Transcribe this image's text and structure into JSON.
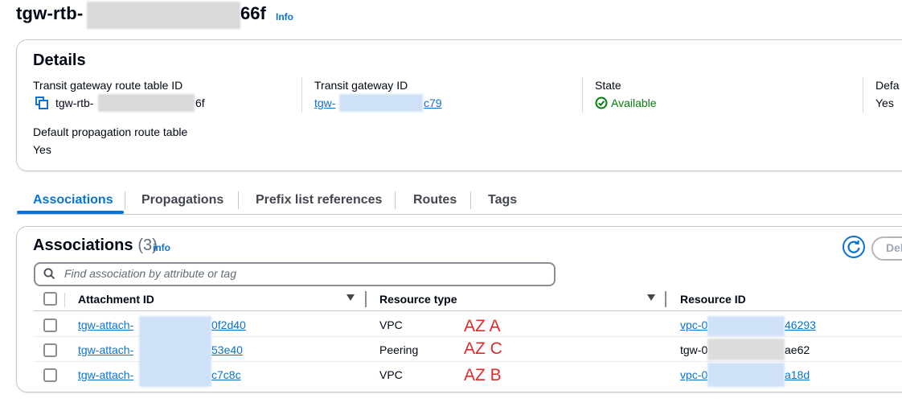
{
  "header": {
    "title_prefix": "tgw-rtb-",
    "title_suffix": "66f",
    "info": "Info"
  },
  "details": {
    "heading": "Details",
    "route_table_id": {
      "label": "Transit gateway route table ID",
      "prefix": "tgw-rtb-",
      "suffix": "6f"
    },
    "gateway_id": {
      "label": "Transit gateway ID",
      "prefix": "tgw-",
      "suffix": "c79"
    },
    "state": {
      "label": "State",
      "value": "Available"
    },
    "default_assoc": {
      "label": "Defa",
      "value": "Yes"
    },
    "default_propagation": {
      "label": "Default propagation route table",
      "value": "Yes"
    }
  },
  "tabs": [
    "Associations",
    "Propagations",
    "Prefix list references",
    "Routes",
    "Tags"
  ],
  "associations": {
    "title": "Associations",
    "count": "(3)",
    "info": "info",
    "delete_label": "Del",
    "search_placeholder": "Find association by attribute or tag",
    "columns": [
      "Attachment ID",
      "Resource type",
      "Resource ID"
    ],
    "rows": [
      {
        "attach_prefix": "tgw-attach-",
        "attach_suffix": "0f2d40",
        "type": "VPC",
        "az": "AZ A",
        "res_prefix": "vpc-0",
        "res_suffix": "46293"
      },
      {
        "attach_prefix": "tgw-attach-",
        "attach_suffix": "53e40",
        "type": "Peering",
        "az": "AZ C",
        "res_prefix": "tgw-0",
        "res_suffix": "ae62"
      },
      {
        "attach_prefix": "tgw-attach-",
        "attach_suffix": "c7c8c",
        "type": "VPC",
        "az": "AZ B",
        "res_prefix": "vpc-0",
        "res_suffix": "a18d"
      }
    ]
  },
  "colors": {
    "accent": "#0972d3",
    "success": "#037f0c",
    "annotation": "#e02b2b"
  }
}
